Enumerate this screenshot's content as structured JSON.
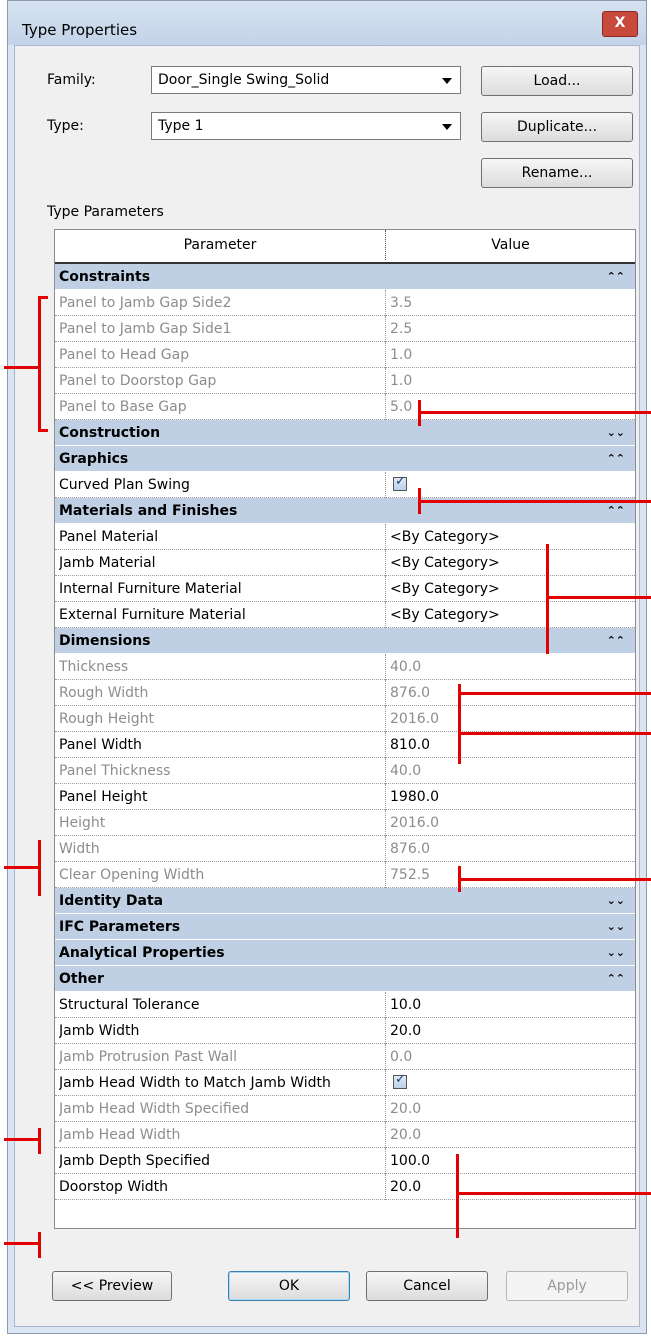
{
  "window": {
    "title": "Type Properties",
    "close": "X"
  },
  "family": {
    "label": "Family:",
    "value": "Door_Single Swing_Solid"
  },
  "type": {
    "label": "Type:",
    "value": "Type 1"
  },
  "buttons": {
    "load": "Load...",
    "duplicate": "Duplicate...",
    "rename": "Rename..."
  },
  "section_title": "Type Parameters",
  "columns": {
    "parameter": "Parameter",
    "value": "Value"
  },
  "groups": {
    "constraints": "Constraints",
    "construction": "Construction",
    "graphics": "Graphics",
    "materials": "Materials and Finishes",
    "dimensions": "Dimensions",
    "identity": "Identity Data",
    "ifc": "IFC Parameters",
    "analytical": "Analytical Properties",
    "other": "Other"
  },
  "chevron": {
    "up": "⌃⌃",
    "down": "⌄⌄"
  },
  "rows": {
    "c1": {
      "p": "Panel to Jamb Gap Side2",
      "v": "3.5"
    },
    "c2": {
      "p": "Panel to Jamb Gap Side1",
      "v": "2.5"
    },
    "c3": {
      "p": "Panel to Head Gap",
      "v": "1.0"
    },
    "c4": {
      "p": "Panel to Doorstop Gap",
      "v": "1.0"
    },
    "c5": {
      "p": "Panel to Base Gap",
      "v": "5.0"
    },
    "g1": {
      "p": "Curved Plan Swing",
      "v": ""
    },
    "m1": {
      "p": "Panel Material",
      "v": "<By Category>"
    },
    "m2": {
      "p": "Jamb Material",
      "v": "<By Category>"
    },
    "m3": {
      "p": "Internal Furniture Material",
      "v": "<By Category>"
    },
    "m4": {
      "p": "External Furniture Material",
      "v": "<By Category>"
    },
    "d1": {
      "p": "Thickness",
      "v": "40.0"
    },
    "d2": {
      "p": "Rough Width",
      "v": "876.0"
    },
    "d3": {
      "p": "Rough Height",
      "v": "2016.0"
    },
    "d4": {
      "p": "Panel Width",
      "v": "810.0"
    },
    "d5": {
      "p": "Panel Thickness",
      "v": "40.0"
    },
    "d6": {
      "p": "Panel Height",
      "v": "1980.0"
    },
    "d7": {
      "p": "Height",
      "v": "2016.0"
    },
    "d8": {
      "p": "Width",
      "v": "876.0"
    },
    "d9": {
      "p": "Clear Opening Width",
      "v": "752.5"
    },
    "o1": {
      "p": "Structural Tolerance",
      "v": "10.0"
    },
    "o2": {
      "p": "Jamb Width",
      "v": "20.0"
    },
    "o3": {
      "p": "Jamb Protrusion Past Wall",
      "v": "0.0"
    },
    "o4": {
      "p": "Jamb Head Width to Match Jamb Width",
      "v": ""
    },
    "o5": {
      "p": "Jamb Head Width Specified",
      "v": "20.0"
    },
    "o6": {
      "p": "Jamb Head Width",
      "v": "20.0"
    },
    "o7": {
      "p": "Jamb Depth Specified",
      "v": "100.0"
    },
    "o8": {
      "p": "Doorstop Width",
      "v": "20.0"
    }
  },
  "footer": {
    "preview": "<< Preview",
    "ok": "OK",
    "cancel": "Cancel",
    "apply": "Apply"
  },
  "colors": {
    "annotation": "#e20000",
    "group_header": "#bfcfe4",
    "disabled_text": "#8d8d8d"
  }
}
